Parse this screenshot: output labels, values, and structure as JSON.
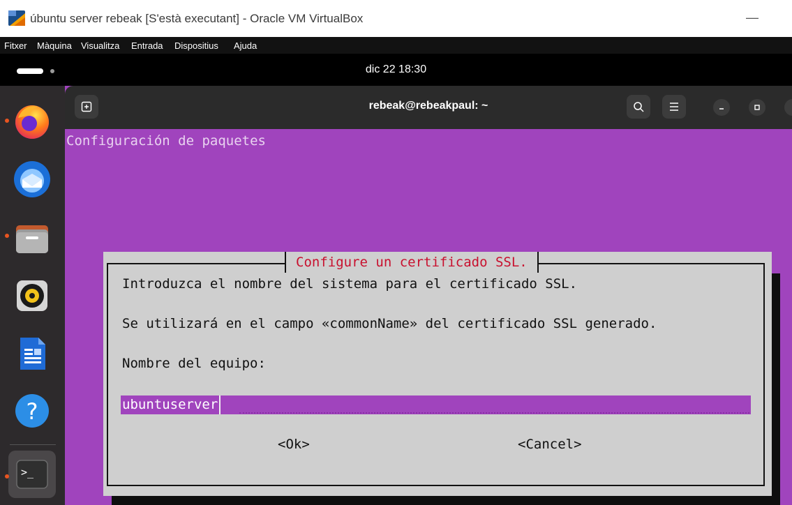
{
  "window": {
    "title": "úbuntu server rebeak [S'està executant] - Oracle VM VirtualBox",
    "minimize_glyph": "—"
  },
  "menubar": {
    "items": [
      "Fitxer",
      "Màquina",
      "Visualitza",
      "Entrada",
      "Dispositius",
      "Ajuda"
    ]
  },
  "topbar": {
    "clock": "dic 22  18:30"
  },
  "dock": {
    "items": [
      {
        "icon": "firefox-icon",
        "running": true
      },
      {
        "icon": "thunderbird-icon",
        "running": false
      },
      {
        "icon": "files-icon",
        "running": true
      },
      {
        "icon": "rhythmbox-icon",
        "running": false
      },
      {
        "icon": "libreoffice-writer-icon",
        "running": false
      },
      {
        "icon": "help-icon",
        "running": false
      },
      {
        "icon": "terminal-icon",
        "running": true
      }
    ],
    "help_glyph": "?",
    "terminal_glyph": ">_"
  },
  "terminal": {
    "title": "rebeak@rebeakpaul: ~",
    "body_title": "Configuración de paquetes",
    "dialog": {
      "title": "Configure un certificado SSL.",
      "line1": "Introduzca el nombre del sistema para el certificado SSL.",
      "line2": "Se utilizará en el campo «commonName» del certificado SSL generado.",
      "label": "Nombre del equipo:",
      "input_value": "ubuntuserver",
      "ok_label": "<Ok>",
      "cancel_label": "<Cancel>"
    }
  },
  "colors": {
    "terminal_bg": "#a044bd",
    "dialog_bg": "#cfcfcf",
    "dialog_title": "#c8102e",
    "ubuntu_orange": "#e95420"
  }
}
